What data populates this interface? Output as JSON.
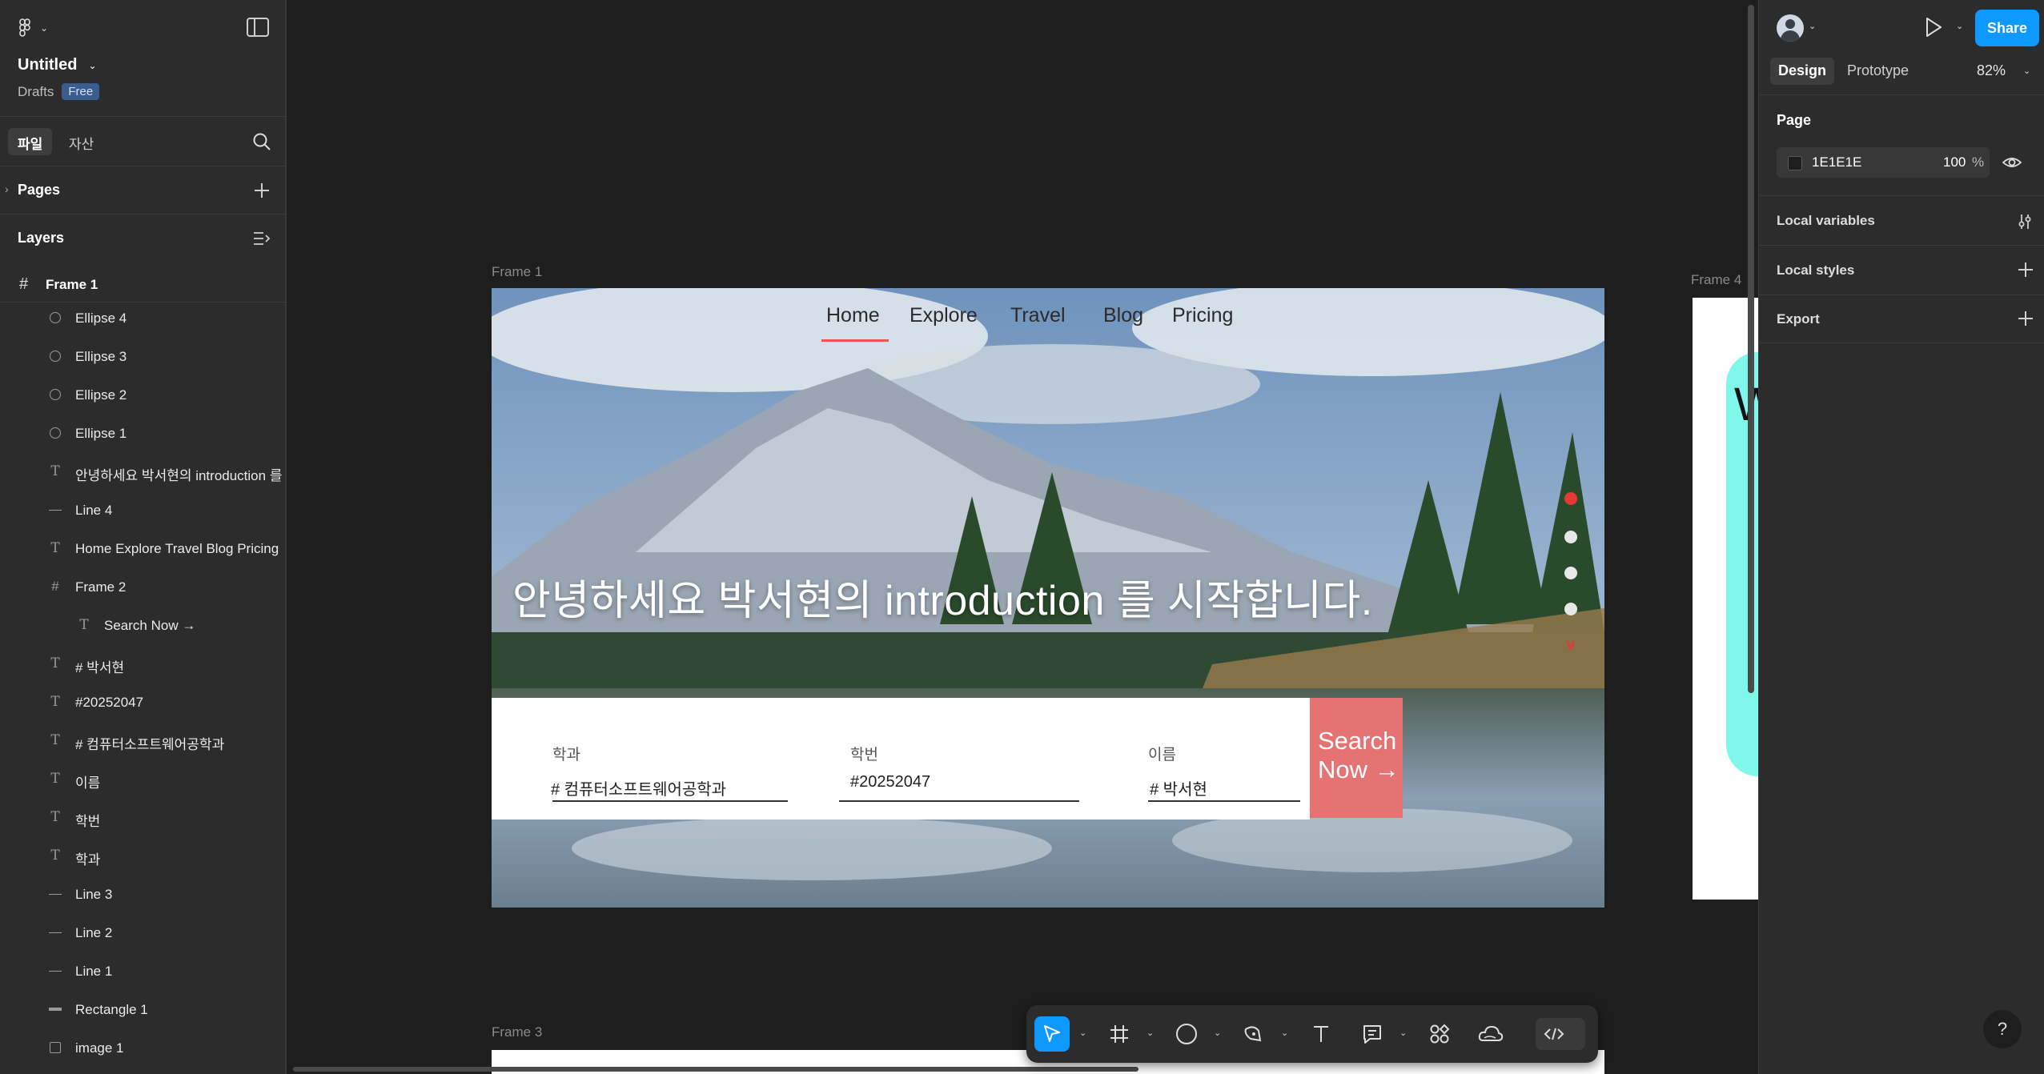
{
  "file": {
    "title": "Untitled",
    "location": "Drafts",
    "plan_badge": "Free"
  },
  "left_tabs": {
    "file": "파일",
    "assets": "자산"
  },
  "pages": {
    "label": "Pages"
  },
  "layers": {
    "label": "Layers",
    "root_frame": "Frame 1",
    "items": [
      {
        "name": "Ellipse 4",
        "type": "ellipse"
      },
      {
        "name": "Ellipse 3",
        "type": "ellipse"
      },
      {
        "name": "Ellipse 2",
        "type": "ellipse"
      },
      {
        "name": "Ellipse 1",
        "type": "ellipse"
      },
      {
        "name": "안녕하세요 박서현의 introduction 를",
        "type": "text"
      },
      {
        "name": "Line 4",
        "type": "line"
      },
      {
        "name": "Home Explore Travel Blog Pricing",
        "type": "text"
      },
      {
        "name": "Frame 2",
        "type": "frame"
      },
      {
        "name": "Search Now →",
        "type": "text",
        "child": true
      },
      {
        "name": "# 박서현",
        "type": "text"
      },
      {
        "name": "#20252047",
        "type": "text"
      },
      {
        "name": "# 컴퓨터소프트웨어공학과",
        "type": "text"
      },
      {
        "name": "이름",
        "type": "text"
      },
      {
        "name": "학번",
        "type": "text"
      },
      {
        "name": "학과",
        "type": "text"
      },
      {
        "name": "Line 3",
        "type": "line"
      },
      {
        "name": "Line 2",
        "type": "line"
      },
      {
        "name": "Line 1",
        "type": "line"
      },
      {
        "name": "Rectangle 1",
        "type": "rect"
      },
      {
        "name": "image 1",
        "type": "image"
      }
    ]
  },
  "canvas": {
    "frame1_label": "Frame 1",
    "frame3_label": "Frame 3",
    "frame4_label": "Frame 4",
    "frame4_partial_letter": "W",
    "nav": [
      "Home",
      "Explore",
      "Travel",
      "Blog",
      "Pricing"
    ],
    "headline": "안녕하세요 박서현의 introduction 를 시작합니다.",
    "form": {
      "dept_label": "학과",
      "dept_value": "# 컴퓨터소프트웨어공학과",
      "id_label": "학번",
      "id_value": "#20252047",
      "name_label": "이름",
      "name_value": "#  박서현"
    },
    "search_button": {
      "line1": "Search",
      "line2": "Now →"
    },
    "slider_caret": "v"
  },
  "toolbar": {
    "tools": [
      "move-tool",
      "frame-tool",
      "shape-tool",
      "pen-tool",
      "text-tool",
      "comment-tool",
      "actions-tool",
      "ai-tool",
      "dev-mode"
    ]
  },
  "right_panel": {
    "share": "Share",
    "tabs": {
      "design": "Design",
      "prototype": "Prototype"
    },
    "zoom": "82%",
    "page_heading": "Page",
    "page_color": "1E1E1E",
    "page_opacity": "100",
    "opacity_unit": "%",
    "local_variables": "Local variables",
    "local_styles": "Local styles",
    "export": "Export",
    "help": "?"
  },
  "colors": {
    "accent": "#0d99ff",
    "canvas_bg": "#1e1e1e",
    "panel_bg": "#2c2c2c",
    "search_button": "#e57373",
    "nav_underline": "#e65454",
    "frame4_accent": "#7ff7ea"
  }
}
